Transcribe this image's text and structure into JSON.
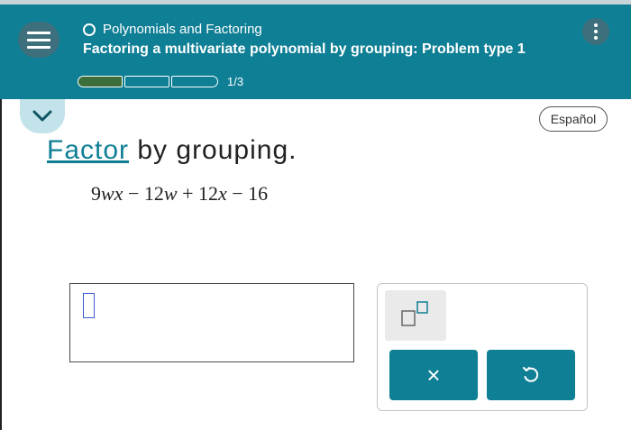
{
  "header": {
    "topic": "Polynomials and Factoring",
    "title": "Factoring a multivariate polynomial by grouping: Problem type 1",
    "progress": {
      "text": "1/3",
      "completed": 1,
      "total": 3
    },
    "colors": {
      "bar": "#0f7f95",
      "progress_done": "#3c6e3a"
    }
  },
  "language_button": "Español",
  "question": {
    "link_word": "Factor",
    "instruction": " by grouping.",
    "expression": {
      "term1_coef": "9",
      "term1_vars": "wx",
      "op1": " − ",
      "term2_coef": "12",
      "term2_vars": "w",
      "op2": " + ",
      "term3_coef": "12",
      "term3_vars": "x",
      "op3": " − ",
      "term4": "16"
    }
  },
  "answer": {
    "value": ""
  },
  "palette": {
    "exponent_icon": "superscript-icon",
    "clear_label": "×",
    "undo_icon": "undo-icon"
  }
}
